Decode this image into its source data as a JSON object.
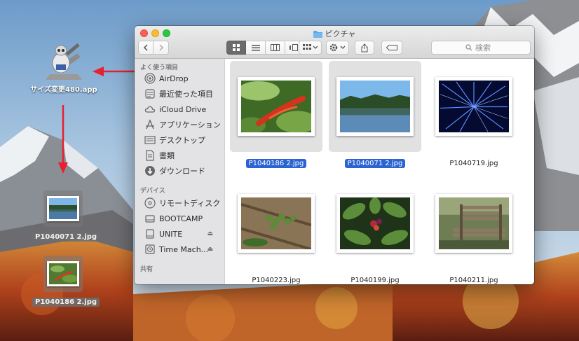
{
  "desktop": {
    "app_icon": {
      "label": "サイズ変更480.app",
      "icon": "automator-robot-icon"
    },
    "dropped_files": [
      {
        "label": "P1040071 2.jpg",
        "kind": "lake"
      },
      {
        "label": "P1040186 2.jpg",
        "kind": "pepper"
      }
    ],
    "arrow_color": "#e8202f"
  },
  "window": {
    "title": "ピクチャ",
    "toolbar": {
      "back_icon": "chevron-left-icon",
      "forward_icon": "chevron-right-icon",
      "view_modes": [
        "icon-view",
        "list-view",
        "column-view",
        "coverflow-view"
      ],
      "active_view": "icon-view",
      "group_icon": "group-grid-icon",
      "action_icon": "gear-icon",
      "share_icon": "share-icon",
      "tag_icon": "tag-icon"
    },
    "search": {
      "placeholder": "検索"
    },
    "sidebar": {
      "sections": [
        {
          "header": "よく使う項目",
          "items": [
            {
              "label": "AirDrop",
              "icon": "airdrop-icon"
            },
            {
              "label": "最近使った項目",
              "icon": "recents-icon"
            },
            {
              "label": "iCloud Drive",
              "icon": "cloud-icon"
            },
            {
              "label": "アプリケーション",
              "icon": "applications-icon"
            },
            {
              "label": "デスクトップ",
              "icon": "desktop-icon"
            },
            {
              "label": "書類",
              "icon": "document-icon"
            },
            {
              "label": "ダウンロード",
              "icon": "download-icon"
            }
          ]
        },
        {
          "header": "デバイス",
          "items": [
            {
              "label": "リモートディスク",
              "icon": "disc-icon"
            },
            {
              "label": "BOOTCAMP",
              "icon": "drive-icon"
            },
            {
              "label": "UNITE",
              "icon": "drive-icon",
              "eject": true
            },
            {
              "label": "Time Mach...",
              "icon": "time-machine-icon",
              "eject": true
            }
          ]
        },
        {
          "header": "共有",
          "items": []
        }
      ]
    },
    "files": [
      {
        "name": "P1040186 2.jpg",
        "selected": true,
        "kind": "pepper"
      },
      {
        "name": "P1040071 2.jpg",
        "selected": true,
        "kind": "lake"
      },
      {
        "name": "P1040719.jpg",
        "selected": false,
        "kind": "lights"
      },
      {
        "name": "P1040223.jpg",
        "selected": false,
        "kind": "berries"
      },
      {
        "name": "P1040199.jpg",
        "selected": false,
        "kind": "plant"
      },
      {
        "name": "P1040211.jpg",
        "selected": false,
        "kind": "bench"
      }
    ],
    "selection_color": "#2b64d2",
    "eject_glyph": "⏏"
  }
}
